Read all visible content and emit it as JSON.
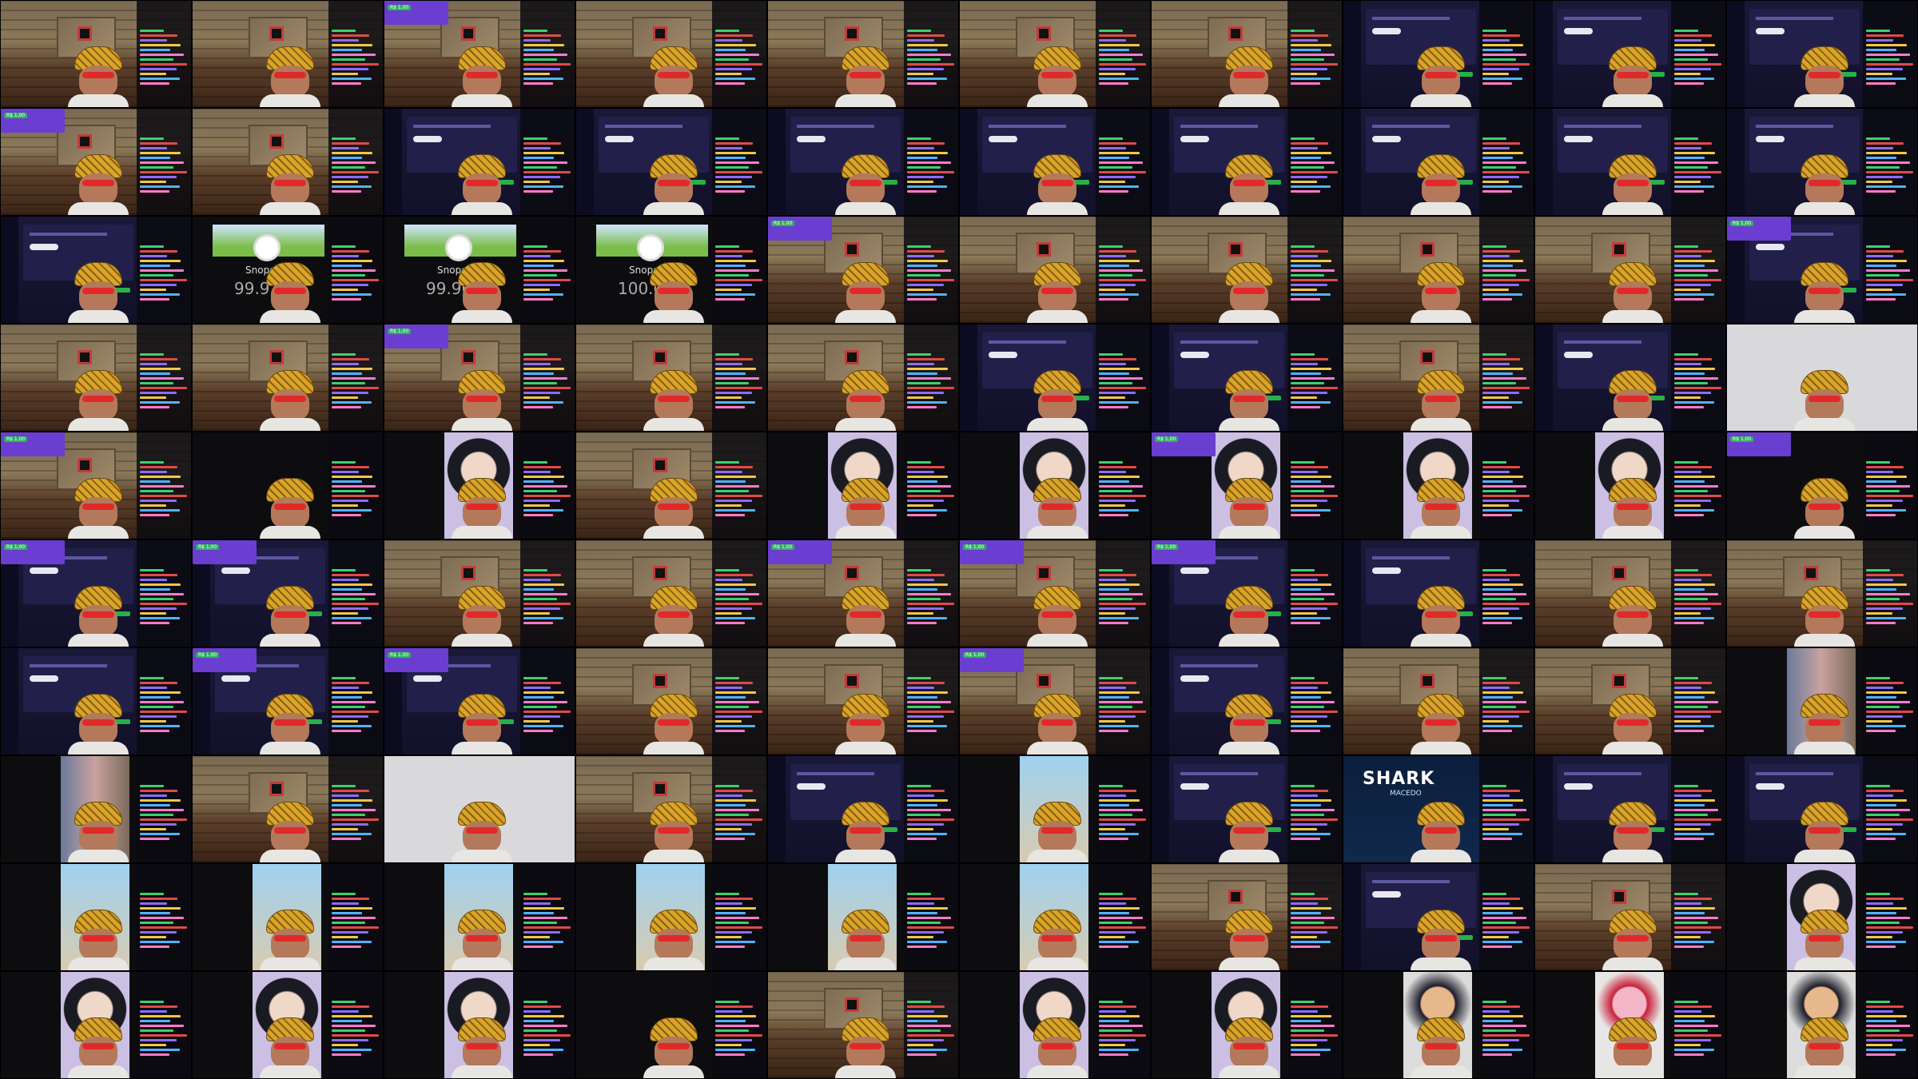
{
  "meta": {
    "cols": 10,
    "rows": 10
  },
  "labels": {
    "snopey_name": "Snopey",
    "shark_title": "SHARK",
    "shark_subtitle": "MACEDO",
    "alert_chip": "R$ 1,00"
  },
  "tiles": [
    {
      "kind": "room"
    },
    {
      "kind": "room"
    },
    {
      "kind": "room",
      "alert": true
    },
    {
      "kind": "room"
    },
    {
      "kind": "room"
    },
    {
      "kind": "room"
    },
    {
      "kind": "room"
    },
    {
      "kind": "dash"
    },
    {
      "kind": "dash"
    },
    {
      "kind": "dash"
    },
    {
      "kind": "room",
      "alert": true
    },
    {
      "kind": "room"
    },
    {
      "kind": "dash"
    },
    {
      "kind": "dash"
    },
    {
      "kind": "dash"
    },
    {
      "kind": "dash"
    },
    {
      "kind": "dash"
    },
    {
      "kind": "dash"
    },
    {
      "kind": "dash"
    },
    {
      "kind": "dash"
    },
    {
      "kind": "dash"
    },
    {
      "kind": "snopey",
      "count": "99.912"
    },
    {
      "kind": "snopey",
      "count": "99.961"
    },
    {
      "kind": "snopey",
      "count": "100.023"
    },
    {
      "kind": "room",
      "alert": true
    },
    {
      "kind": "room"
    },
    {
      "kind": "room"
    },
    {
      "kind": "room"
    },
    {
      "kind": "room"
    },
    {
      "kind": "dash",
      "alert": true
    },
    {
      "kind": "room"
    },
    {
      "kind": "room"
    },
    {
      "kind": "room",
      "alert": true
    },
    {
      "kind": "room"
    },
    {
      "kind": "room"
    },
    {
      "kind": "dash"
    },
    {
      "kind": "dash"
    },
    {
      "kind": "room"
    },
    {
      "kind": "dash"
    },
    {
      "kind": "white"
    },
    {
      "kind": "room",
      "alert": true
    },
    {
      "kind": "dark"
    },
    {
      "kind": "girl"
    },
    {
      "kind": "room"
    },
    {
      "kind": "girl"
    },
    {
      "kind": "girl"
    },
    {
      "kind": "girl",
      "alert": true
    },
    {
      "kind": "girl"
    },
    {
      "kind": "girl"
    },
    {
      "kind": "dark",
      "alert": true
    },
    {
      "kind": "dash",
      "alert": true
    },
    {
      "kind": "dash",
      "alert": true
    },
    {
      "kind": "room"
    },
    {
      "kind": "room"
    },
    {
      "kind": "room",
      "alert": true
    },
    {
      "kind": "room",
      "alert": true
    },
    {
      "kind": "dash",
      "alert": true
    },
    {
      "kind": "dash"
    },
    {
      "kind": "room"
    },
    {
      "kind": "room"
    },
    {
      "kind": "dash"
    },
    {
      "kind": "dash",
      "alert": true
    },
    {
      "kind": "dash",
      "alert": true
    },
    {
      "kind": "room"
    },
    {
      "kind": "room"
    },
    {
      "kind": "room",
      "alert": true
    },
    {
      "kind": "dash"
    },
    {
      "kind": "room"
    },
    {
      "kind": "room"
    },
    {
      "kind": "crowd"
    },
    {
      "kind": "crowd"
    },
    {
      "kind": "room"
    },
    {
      "kind": "white"
    },
    {
      "kind": "room"
    },
    {
      "kind": "dash"
    },
    {
      "kind": "street"
    },
    {
      "kind": "dash"
    },
    {
      "kind": "shark"
    },
    {
      "kind": "dash"
    },
    {
      "kind": "dash"
    },
    {
      "kind": "street"
    },
    {
      "kind": "street"
    },
    {
      "kind": "street"
    },
    {
      "kind": "street"
    },
    {
      "kind": "street"
    },
    {
      "kind": "street"
    },
    {
      "kind": "room"
    },
    {
      "kind": "dash"
    },
    {
      "kind": "room"
    },
    {
      "kind": "girl"
    },
    {
      "kind": "girl"
    },
    {
      "kind": "girl"
    },
    {
      "kind": "girl"
    },
    {
      "kind": "dark"
    },
    {
      "kind": "room"
    },
    {
      "kind": "girl"
    },
    {
      "kind": "girl"
    },
    {
      "kind": "naruto"
    },
    {
      "kind": "pink"
    },
    {
      "kind": "naruto"
    }
  ],
  "chat_colors": [
    "#3bd16f",
    "#e04a4a",
    "#8e6cff",
    "#f3c744",
    "#4fb3ff",
    "#ff7acb"
  ]
}
